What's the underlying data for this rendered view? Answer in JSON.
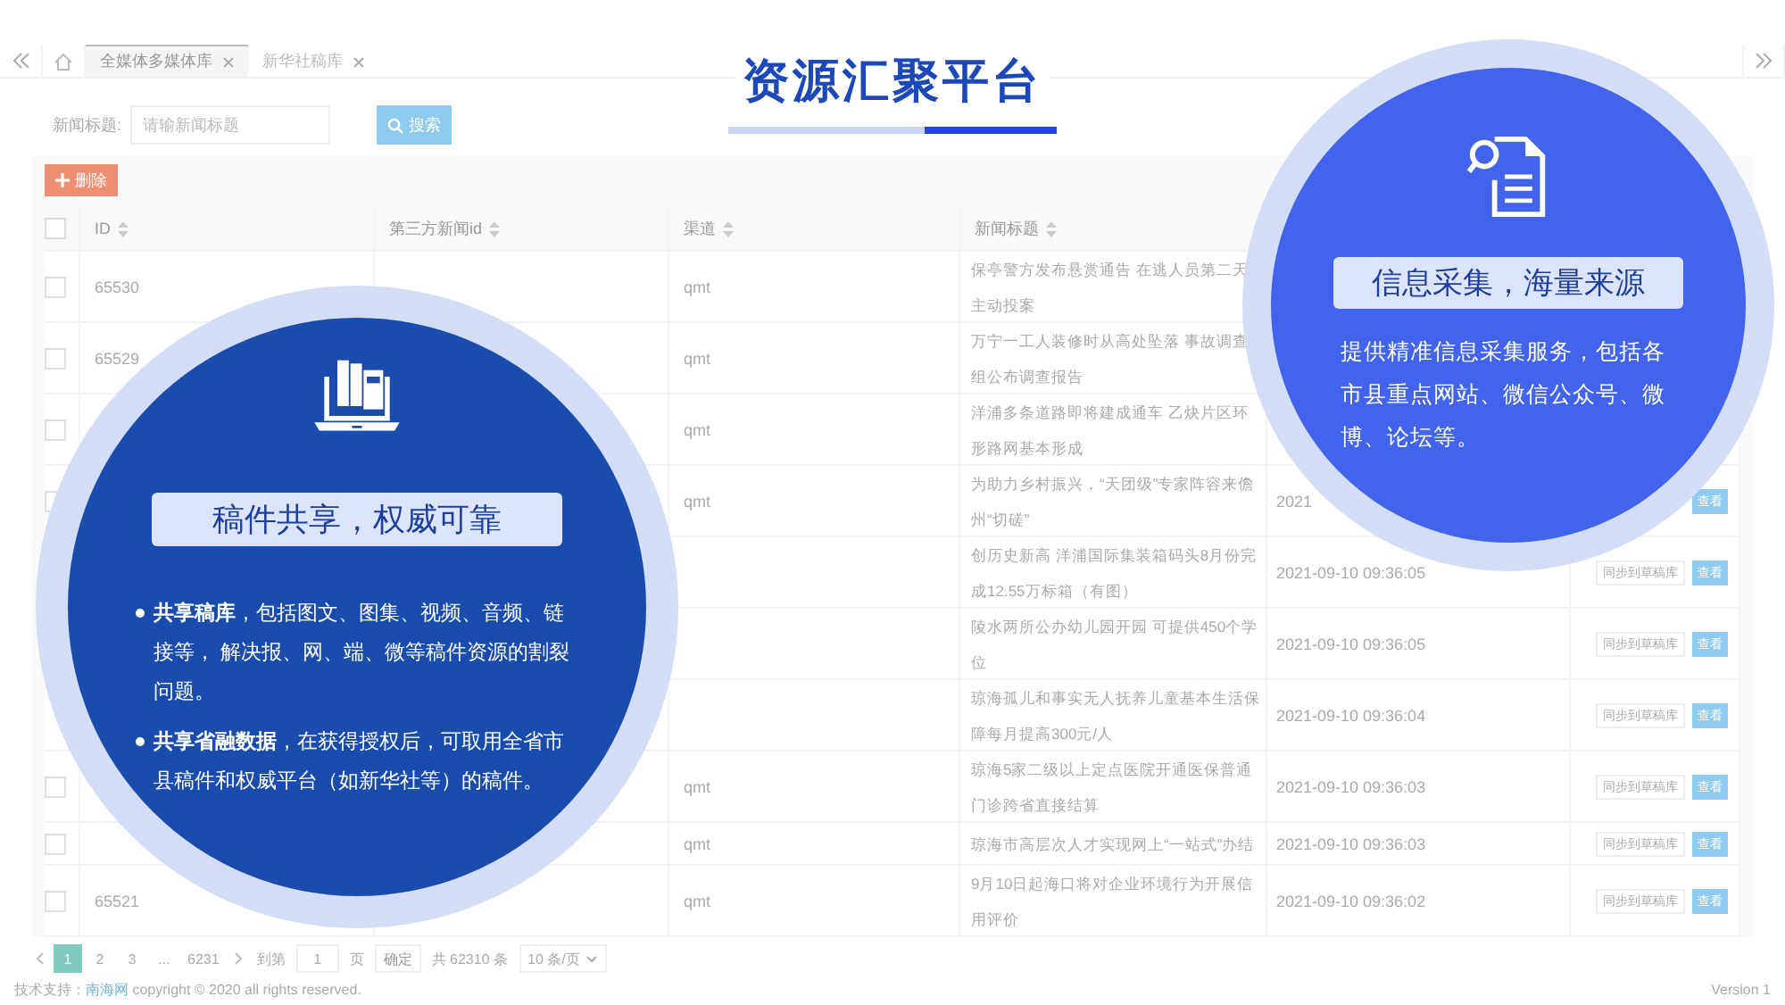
{
  "tab_bar": {
    "tabs": [
      {
        "label": "全媒体多媒体库",
        "selected": true
      },
      {
        "label": "新华社稿库",
        "selected": false
      }
    ]
  },
  "overlay_title": "资源汇聚平台",
  "search": {
    "label": "新闻标题:",
    "placeholder": "请输新闻标题",
    "button": "搜索"
  },
  "toolbar": {
    "delete_button": "删除"
  },
  "table": {
    "header_checkbox": {
      "checked": false
    },
    "columns": [
      "ID",
      "第三方新闻id",
      "渠道",
      "新闻标题"
    ],
    "rows": [
      {
        "checkbox": {
          "checked": false
        },
        "id": "65530",
        "channel": "qmt",
        "title": "保亭警方发布悬赏通告 在逃人员第二天主动投案"
      },
      {
        "checkbox": {
          "checked": false
        },
        "id": "65529",
        "channel": "qmt",
        "title": "万宁一工人装修时从高处坠落 事故调查组公布调查报告"
      },
      {
        "checkbox": {
          "checked": false
        },
        "channel": "qmt",
        "title": "洋浦多条道路即将建成通车 乙炔片区环形路网基本形成"
      },
      {
        "checkbox": {
          "checked": false
        },
        "channel": "qmt",
        "title": "为助力乡村振兴，“天团级”专家阵容来儋州“切磋”",
        "time": "2021",
        "actions": [
          {
            "kind": "view",
            "label": "查看"
          }
        ]
      },
      {
        "title": "创历史新高 洋浦国际集装箱码头8月份完成12.55万标箱（有图）",
        "time": "2021-09-10 09:36:05",
        "actions": [
          {
            "kind": "sync",
            "label": "同步到草稿库"
          },
          {
            "kind": "view",
            "label": "查看"
          }
        ]
      },
      {
        "title": "陵水两所公办幼儿园开园 可提供450个学位",
        "time": "2021-09-10 09:36:05",
        "actions": [
          {
            "kind": "sync",
            "label": "同步到草稿库"
          },
          {
            "kind": "view",
            "label": "查看"
          }
        ]
      },
      {
        "title": "琼海孤儿和事实无人抚养儿童基本生活保障每月提高300元/人",
        "time": "2021-09-10 09:36:04",
        "actions": [
          {
            "kind": "sync",
            "label": "同步到草稿库"
          },
          {
            "kind": "view",
            "label": "查看"
          }
        ]
      },
      {
        "checkbox": {
          "checked": false
        },
        "channel": "qmt",
        "title": "琼海5家二级以上定点医院开通医保普通门诊跨省直接结算",
        "time": "2021-09-10 09:36:03",
        "actions": [
          {
            "kind": "sync",
            "label": "同步到草稿库"
          },
          {
            "kind": "view",
            "label": "查看"
          }
        ]
      },
      {
        "checkbox": {
          "checked": false
        },
        "channel": "qmt",
        "title": "琼海市高层次人才实现网上“一站式”办结",
        "time": "2021-09-10 09:36:03",
        "actions": [
          {
            "kind": "sync",
            "label": "同步到草稿库"
          },
          {
            "kind": "view",
            "label": "查看"
          }
        ]
      },
      {
        "checkbox": {
          "checked": false
        },
        "id": "65521",
        "channel": "qmt",
        "title": "9月10日起海口将对企业环境行为开展信用评价",
        "time": "2021-09-10 09:36:02",
        "actions": [
          {
            "kind": "sync",
            "label": "同步到草稿库"
          },
          {
            "kind": "view",
            "label": "查看"
          }
        ]
      }
    ]
  },
  "pagination": {
    "pages": [
      {
        "label": "1",
        "selected": true
      },
      {
        "label": "2",
        "selected": false
      },
      {
        "label": "3",
        "selected": false
      },
      {
        "label": "...",
        "selected": false
      },
      {
        "label": "6231",
        "selected": false
      }
    ],
    "goto_label": "到第",
    "goto_value": "1",
    "goto_suffix": "页",
    "goto_button": "确定",
    "total": "共 62310 条",
    "page_size": "10 条/页"
  },
  "footer": {
    "prefix": "技术支持：",
    "link": "南海网",
    "text": "copyright © 2020 all rights reserved.",
    "version": "Version 1"
  },
  "left_card": {
    "heading": "稿件共享，权威可靠",
    "bullets": [
      "**共享稿库**，包括图文、图集、视频、音频、链接等， 解决报、网、端、微等稿件资源的割裂问题。",
      "**共享省融数据**，在获得授权后，可取用全省市县稿件和权威平台（如新华社等）的稿件。"
    ]
  },
  "right_card": {
    "heading": "信息采集，海量来源",
    "text": "提供精准信息采集服务，包括各市县重点网站、微信公众号、微博、论坛等。"
  }
}
